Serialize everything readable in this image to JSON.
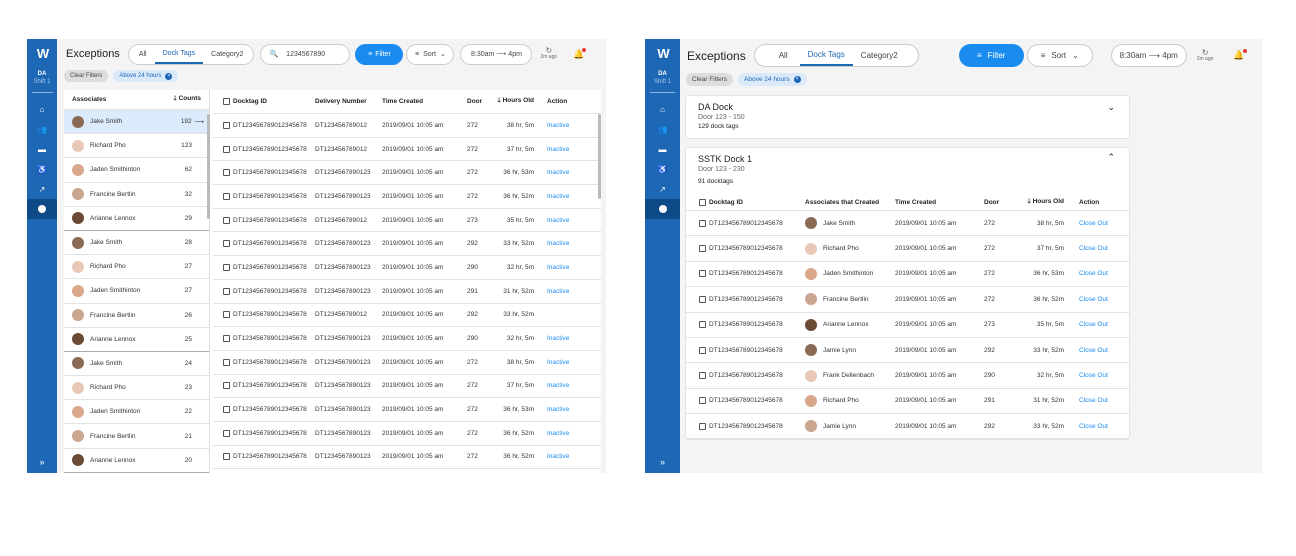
{
  "colors": {
    "sidebar": "#1d67b5",
    "accent": "#1a8cf0",
    "link": "#1a8cf0"
  },
  "app": {
    "logo": "W",
    "shift_name": "DA",
    "shift_sub": "Shift 1",
    "title": "Exceptions"
  },
  "nav_icons": [
    "home-icon",
    "people-icon",
    "truck-icon",
    "walker-icon",
    "trend-icon",
    "circle-icon"
  ],
  "tabs": [
    "All",
    "Dock Tags",
    "Category2"
  ],
  "search": {
    "value": "1234567890"
  },
  "toolbar": {
    "filter": "Filter",
    "sort": "Sort",
    "time_from": "8:30am",
    "time_arrow": "⟶",
    "time_to": "4pm",
    "refresh_label": "2m ago",
    "expand": "»"
  },
  "filters": {
    "clear": "Clear Filters",
    "active": "Above 24 hours"
  },
  "left": {
    "assoc_header": "Associates",
    "counts_header": "Counts",
    "associates": [
      {
        "name": "Jake Smith",
        "count": "192"
      },
      {
        "name": "Richard Pho",
        "count": "123"
      },
      {
        "name": "Jaden Smithinton",
        "count": "62"
      },
      {
        "name": "Francine Bertlin",
        "count": "32"
      },
      {
        "name": "Arianne Lennox",
        "count": "29"
      },
      {
        "name": "Jake Smith",
        "count": "28"
      },
      {
        "name": "Richard Pho",
        "count": "27"
      },
      {
        "name": "Jaden Smithinton",
        "count": "27"
      },
      {
        "name": "Francine Bertlin",
        "count": "26"
      },
      {
        "name": "Arianne Lennox",
        "count": "25"
      },
      {
        "name": "Jake Smith",
        "count": "24"
      },
      {
        "name": "Richard Pho",
        "count": "23"
      },
      {
        "name": "Jaden Smithinton",
        "count": "22"
      },
      {
        "name": "Francine Bertlin",
        "count": "21"
      },
      {
        "name": "Arianne Lennox",
        "count": "20"
      }
    ],
    "selected_arrow": "⟶",
    "cols": [
      "Docktag ID",
      "Delivery Number",
      "Time Created",
      "Door",
      "Hours Old",
      "Action"
    ],
    "rows": [
      {
        "id": "DT123456789012345678",
        "del": "DT123456789012",
        "time": "2019/09/01 10:05 am",
        "door": "272",
        "hours": "38 hr, 5m",
        "action": "Inactive"
      },
      {
        "id": "DT123456789012345678",
        "del": "DT123456789012",
        "time": "2019/09/01 10:05 am",
        "door": "272",
        "hours": "37 hr, 5m",
        "action": "Inactive"
      },
      {
        "id": "DT123456789012345678",
        "del": "DT1234567890123",
        "time": "2019/09/01 10:05 am",
        "door": "272",
        "hours": "36 hr, 53m",
        "action": "Inactive"
      },
      {
        "id": "DT123456789012345678",
        "del": "DT1234567890123",
        "time": "2019/09/01 10:05 am",
        "door": "272",
        "hours": "36 hr, 52m",
        "action": "Inactive"
      },
      {
        "id": "DT123456789012345678",
        "del": "DT123456789012",
        "time": "2019/09/01 10:05 am",
        "door": "273",
        "hours": "35 hr, 5m",
        "action": "Inactive"
      },
      {
        "id": "DT123456789012345678",
        "del": "DT1234567890123",
        "time": "2019/09/01 10:05 am",
        "door": "292",
        "hours": "33 hr, 52m",
        "action": "Inactive"
      },
      {
        "id": "DT123456789012345678",
        "del": "DT1234567890123",
        "time": "2019/09/01 10:05 am",
        "door": "290",
        "hours": "32 hr, 5m",
        "action": "Inactive"
      },
      {
        "id": "DT123456789012345678",
        "del": "DT1234567890123",
        "time": "2019/09/01 10:05 am",
        "door": "291",
        "hours": "31 hr, 52m",
        "action": "Inactive"
      },
      {
        "id": "DT123456789012345678",
        "del": "DT123456789012",
        "time": "2019/09/01 10:05 am",
        "door": "292",
        "hours": "33 hr, 52m",
        "action": ""
      },
      {
        "id": "DT123456789012345678",
        "del": "DT1234567890123",
        "time": "2019/09/01 10:05 am",
        "door": "290",
        "hours": "32 hr, 5m",
        "action": "Inactive"
      },
      {
        "id": "DT123456789012345678",
        "del": "DT1234567890123",
        "time": "2019/09/01 10:05 am",
        "door": "272",
        "hours": "38 hr, 5m",
        "action": "Inactive"
      },
      {
        "id": "DT123456789012345678",
        "del": "DT1234567890123",
        "time": "2019/09/01 10:05 am",
        "door": "272",
        "hours": "37 hr, 5m",
        "action": "Inactive"
      },
      {
        "id": "DT123456789012345678",
        "del": "DT1234567890123",
        "time": "2019/09/01 10:05 am",
        "door": "272",
        "hours": "36 hr, 53m",
        "action": "Inactive"
      },
      {
        "id": "DT123456789012345678",
        "del": "DT1234567890123",
        "time": "2019/09/01 10:05 am",
        "door": "272",
        "hours": "36 hr, 52m",
        "action": "Inactive"
      },
      {
        "id": "DT123456789012345678",
        "del": "DT1234567890123",
        "time": "2019/09/01 10:05 am",
        "door": "272",
        "hours": "36 hr, 52m",
        "action": "Inactive"
      }
    ]
  },
  "right": {
    "dock1": {
      "name": "DA Dock",
      "doors": "Door 123 - 150",
      "count": "129 dock tags"
    },
    "dock2": {
      "name": "SSTK Dock 1",
      "doors": "Door 123 - 230",
      "count": "91 docktags"
    },
    "cols": [
      "Docktag ID",
      "Associates that Created",
      "Time Created",
      "Door",
      "Hours Old",
      "Action"
    ],
    "rows": [
      {
        "id": "DT123456789012345678",
        "assoc": "Jake Smith",
        "time": "2019/09/01 10:05 am",
        "door": "272",
        "hours": "38 hr, 5m",
        "action": "Close Out"
      },
      {
        "id": "DT123456789012345678",
        "assoc": "Richard Pho",
        "time": "2019/09/01 10:05 am",
        "door": "272",
        "hours": "37 hr, 5m",
        "action": "Close Out"
      },
      {
        "id": "DT123456789012345678",
        "assoc": "Jaden Smithinton",
        "time": "2019/09/01 10:05 am",
        "door": "272",
        "hours": "36 hr, 53m",
        "action": "Close Out"
      },
      {
        "id": "DT123456789012345678",
        "assoc": "Francine Bertlin",
        "time": "2019/09/01 10:05 am",
        "door": "272",
        "hours": "36 hr, 52m",
        "action": "Close Out"
      },
      {
        "id": "DT123456789012345678",
        "assoc": "Arianne Lennox",
        "time": "2019/09/01 10:05 am",
        "door": "273",
        "hours": "35 hr, 5m",
        "action": "Close Out"
      },
      {
        "id": "DT123456789012345678",
        "assoc": "Jamie Lynn",
        "time": "2019/09/01 10:05 am",
        "door": "292",
        "hours": "33 hr, 52m",
        "action": "Close Out"
      },
      {
        "id": "DT123456789012345678",
        "assoc": "Frank Dellenbach",
        "time": "2019/09/01 10:05 am",
        "door": "290",
        "hours": "32 hr, 5m",
        "action": "Close Out"
      },
      {
        "id": "DT123456789012345678",
        "assoc": "Richard Pho",
        "time": "2019/09/01 10:05 am",
        "door": "291",
        "hours": "31 hr, 52m",
        "action": "Close Out"
      },
      {
        "id": "DT123456789012345678",
        "assoc": "Jamie Lynn",
        "time": "2019/09/01 10:05 am",
        "door": "292",
        "hours": "33 hr, 52m",
        "action": "Close Out"
      }
    ]
  }
}
